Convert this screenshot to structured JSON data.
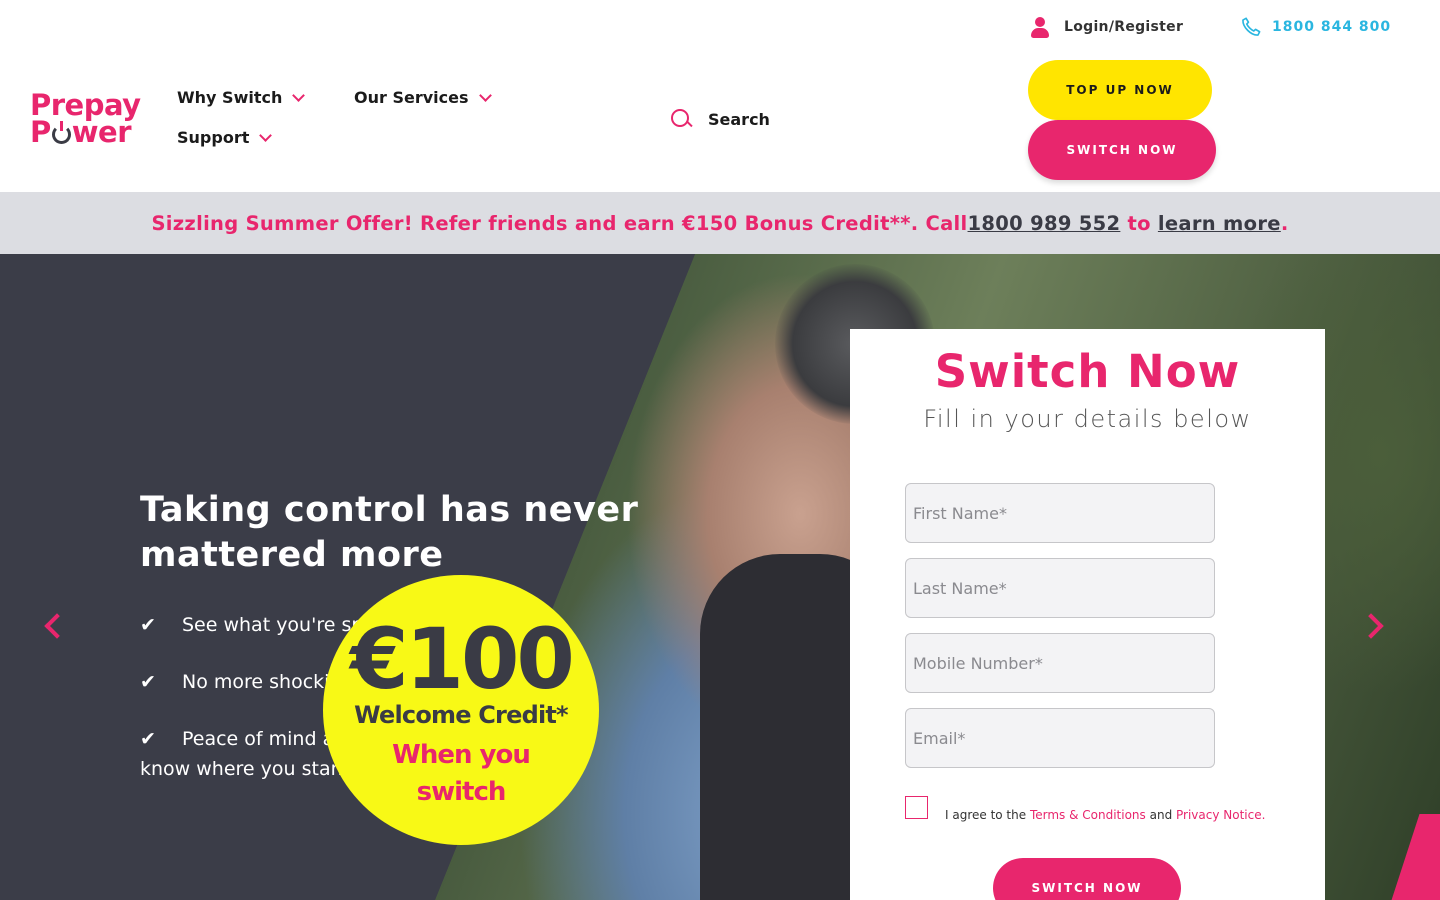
{
  "brand": {
    "line1": "Prepay",
    "line2_pre": "P",
    "line2_post": "wer"
  },
  "nav": {
    "why_switch": "Why Switch",
    "our_services": "Our Services",
    "support": "Support"
  },
  "search": {
    "label": "Search"
  },
  "utility": {
    "login": "Login/Register",
    "phone": "1800 844 800"
  },
  "cta": {
    "top_up": "TOP UP NOW",
    "switch": "SWITCH NOW"
  },
  "promo": {
    "text_before": "Sizzling Summer Offer! Refer friends and earn €150 Bonus Credit**. Call ",
    "phone_link": "1800 989 552",
    "text_mid": " to ",
    "learn_link": "learn more",
    "text_end": "."
  },
  "hero": {
    "title": "Taking control has never mattered more",
    "bullets": [
      "See what you're spending every day",
      "No more shocking bills",
      "Peace of mind as you always know where you stand"
    ],
    "tick": "✔",
    "badge": {
      "amount": "€100",
      "welcome": "Welcome Credit*",
      "line1": "When you",
      "line2": "switch"
    }
  },
  "form": {
    "title": "Switch Now",
    "subtitle": "Fill in your details below",
    "first_name_placeholder": "First Name*",
    "last_name_placeholder": "Last Name*",
    "mobile_placeholder": "Mobile Number*",
    "email_placeholder": "Email*",
    "agree_text": "I agree to the ",
    "terms_link": "Terms & Conditions",
    "and_text": " and ",
    "privacy_link": "Privacy Notice.",
    "submit": "SWITCH NOW"
  },
  "colors": {
    "brand_pink": "#e8266d",
    "brand_yellow": "#ffe500",
    "phone_blue": "#2ab6e0",
    "hero_dark": "#3b3d48",
    "promo_bg": "#dcdde2"
  }
}
